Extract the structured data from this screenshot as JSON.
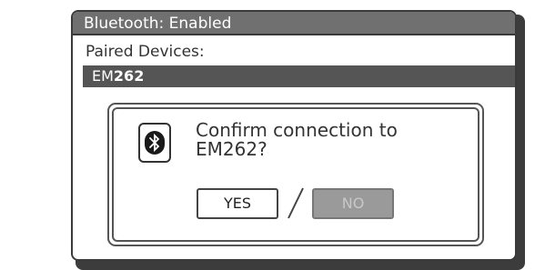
{
  "window": {
    "title": "Bluetooth: Enabled"
  },
  "paired": {
    "label": "Paired Devices:",
    "devices": [
      {
        "prefix": "EM",
        "number": "262",
        "selected": true
      }
    ]
  },
  "dialog": {
    "icon": "bluetooth-icon",
    "message_line1": "Confirm connection to",
    "message_line2": "EM262?",
    "yes_label": "YES",
    "no_label": "NO",
    "separator": "/"
  },
  "colors": {
    "titlebar_bg": "#707070",
    "selected_row_bg": "#555555",
    "no_button_bg": "#9a9a9a",
    "border": "#3a3a3a"
  }
}
